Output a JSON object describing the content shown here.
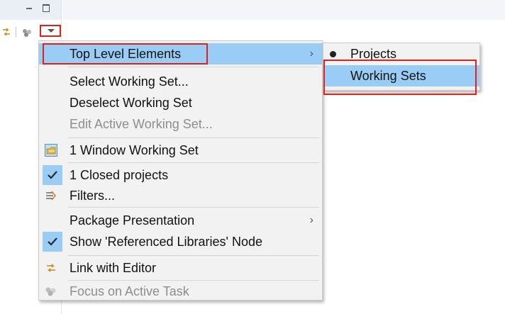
{
  "menu": {
    "items": [
      {
        "label": "Top Level Elements"
      },
      {
        "label": "Select Working Set..."
      },
      {
        "label": "Deselect Working Set"
      },
      {
        "label": "Edit Active Working Set..."
      },
      {
        "label": "1 Window Working Set"
      },
      {
        "label": "1 Closed projects"
      },
      {
        "label": "Filters..."
      },
      {
        "label": "Package Presentation"
      },
      {
        "label": "Show 'Referenced Libraries' Node"
      },
      {
        "label": "Link with Editor"
      },
      {
        "label": "Focus on Active Task"
      }
    ],
    "submenu_arrow": "›"
  },
  "submenu": {
    "items": [
      {
        "label": "Projects"
      },
      {
        "label": "Working Sets"
      }
    ]
  },
  "icons": {
    "link_icon": "link-with-editor-icon",
    "focus_icon": "focus-task-icon",
    "menu_icon": "view-menu-dropdown-icon",
    "check": "checkmark-icon",
    "window_working_set": "working-set-icon",
    "filters": "filters-icon"
  },
  "colors": {
    "highlight": "#99cdf5",
    "annotation": "#e0201c",
    "menu_bg": "#f2f2f2"
  }
}
